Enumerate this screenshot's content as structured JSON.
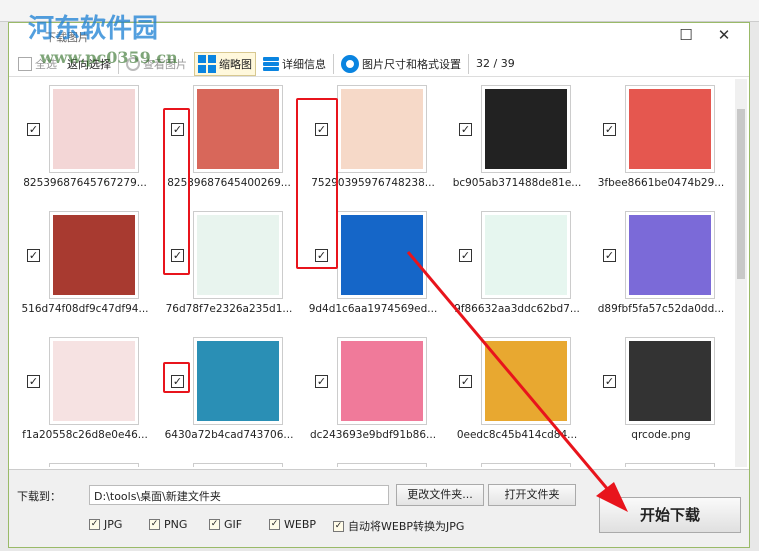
{
  "window": {
    "title": "下载图片",
    "watermark": "河东软件园",
    "watermark_url": "www.pc0359.cn"
  },
  "toolbar": {
    "select_all": "全选",
    "invert": "返向选择",
    "view": "查看图片",
    "thumbnail": "缩略图",
    "details": "详细信息",
    "settings": "图片尺寸和格式设置",
    "count": "32 / 39"
  },
  "files": [
    {
      "name": "82539687645767279...",
      "color": "#f3d6d6"
    },
    {
      "name": "82539687645400269...",
      "color": "#d8675a"
    },
    {
      "name": "75290395976748238...",
      "color": "#f6d9c8"
    },
    {
      "name": "bc905ab371488de81e...",
      "color": "#222222"
    },
    {
      "name": "3fbee8661be0474b29...",
      "color": "#e5574f"
    },
    {
      "name": "516d74f08df9c47df94...",
      "color": "#a83a30"
    },
    {
      "name": "76d78f7e2326a235d1...",
      "color": "#e8f4ee"
    },
    {
      "name": "9d4d1c6aa1974569ed...",
      "color": "#1566c8"
    },
    {
      "name": "9f86632aa3ddc62bd7...",
      "color": "#e6f6ef"
    },
    {
      "name": "d89fbf5fa57c52da0dd...",
      "color": "#7b6ad8"
    },
    {
      "name": "f1a20558c26d8e0e46...",
      "color": "#f6e2e2"
    },
    {
      "name": "6430a72b4cad743706...",
      "color": "#2a8fb5"
    },
    {
      "name": "dc243693e9bdf91b86...",
      "color": "#f07a9a"
    },
    {
      "name": "0eedc8c45b414cd84...",
      "color": "#e8a830"
    },
    {
      "name": "qrcode.png",
      "color": "#333333"
    }
  ],
  "bottom": {
    "download_to": "下载到：",
    "path": "D:\\tools\\桌面\\新建文件夹",
    "change_folder": "更改文件夹...",
    "open_folder": "打开文件夹",
    "start": "开始下载",
    "options": [
      {
        "label": "JPG",
        "checked": true
      },
      {
        "label": "PNG",
        "checked": true
      },
      {
        "label": "GIF",
        "checked": true
      },
      {
        "label": "WEBP",
        "checked": true
      },
      {
        "label": "自动将WEBP转换为JPG",
        "checked": true
      }
    ]
  },
  "check_mark": "✓"
}
